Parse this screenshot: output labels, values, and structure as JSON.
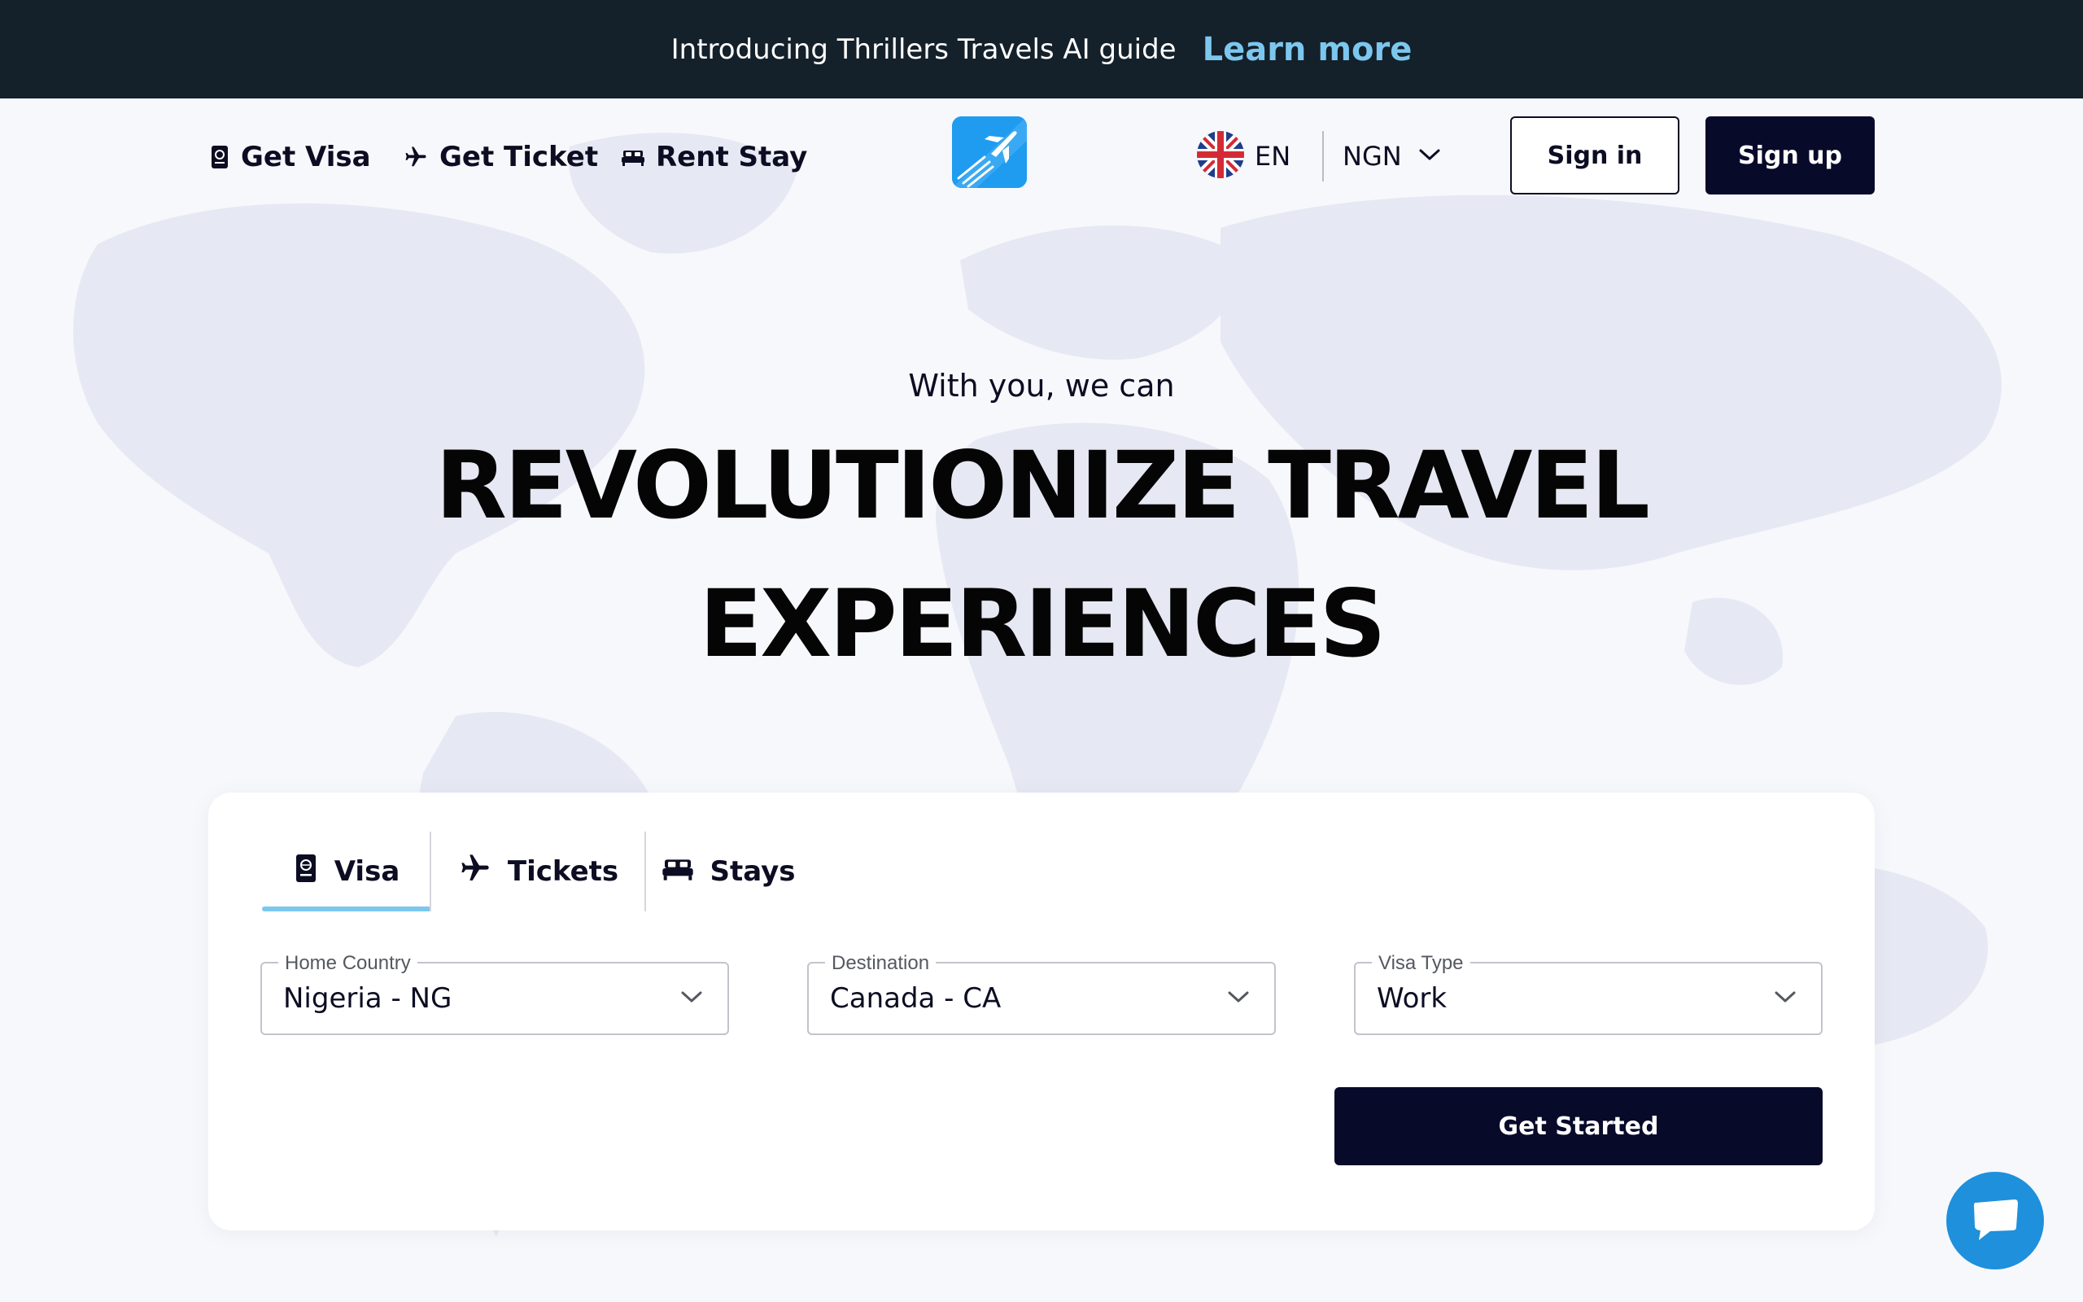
{
  "announcement": {
    "text": "Introducing Thrillers Travels AI guide",
    "link_label": "Learn more"
  },
  "nav": {
    "links": [
      {
        "label": "Get Visa",
        "icon": "passport-icon"
      },
      {
        "label": "Get Ticket",
        "icon": "airplane-icon"
      },
      {
        "label": "Rent Stay",
        "icon": "bed-icon"
      }
    ],
    "logo_icon": "airplane-logo-icon",
    "language": {
      "code": "EN",
      "flag_icon": "uk-flag-icon"
    },
    "currency": "NGN",
    "sign_in_label": "Sign in",
    "sign_up_label": "Sign up"
  },
  "hero": {
    "subtitle": "With you, we can",
    "title_line1": "REVOLUTIONIZE TRAVEL",
    "title_line2": "EXPERIENCES"
  },
  "search": {
    "tabs": [
      {
        "label": "Visa",
        "icon": "passport-icon",
        "active": true
      },
      {
        "label": "Tickets",
        "icon": "airplane-icon",
        "active": false
      },
      {
        "label": "Stays",
        "icon": "bed-icon",
        "active": false
      }
    ],
    "fields": [
      {
        "label": "Home Country",
        "value": "Nigeria - NG"
      },
      {
        "label": "Destination",
        "value": "Canada - CA"
      },
      {
        "label": "Visa Type",
        "value": "Work"
      }
    ],
    "submit_label": "Get Started"
  },
  "chat": {
    "icon": "chat-bubble-icon"
  },
  "colors": {
    "announcement_bg": "#14202a",
    "link_accent": "#7cc7ee",
    "primary_dark": "#080a2a",
    "logo_blue": "#1f9cf0",
    "chat_blue": "#1e90dc",
    "page_bg": "#f7f8fc"
  }
}
